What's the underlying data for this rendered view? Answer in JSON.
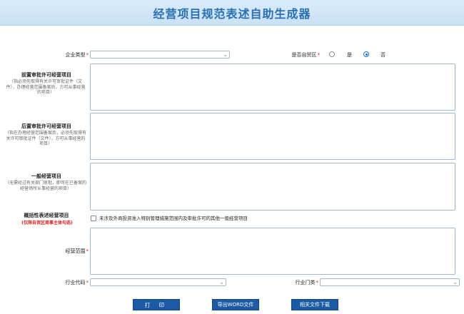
{
  "header": {
    "title": "经营项目规范表述自助生成器"
  },
  "form": {
    "enterprise_type": {
      "label": "企业类型",
      "value": ""
    },
    "free_trade_zone": {
      "label": "是否自贸区",
      "options": [
        "是",
        "否"
      ],
      "selected": "否"
    },
    "pre_approval": {
      "label": "前置审批许可经营项目",
      "note": "（指必须先取得有关许可审批证件（文件），办理经营范围备案后，方可从事经营的项目）",
      "value": ""
    },
    "post_approval": {
      "label": "后置审批许可经营项目",
      "note": "（指在办理经营范围备案后，必须先取得有关许可审批证件（文件），方可从事经营的项目）",
      "value": ""
    },
    "general": {
      "label": "一般经营项目",
      "note": "（无需经过有关部门审批，即可在已备案的经营场所从事经营的项目）",
      "value": ""
    },
    "summary": {
      "label": "概括性表述经营项目",
      "note": "(仅限自贸区商事主体勾选)",
      "checkbox_label": "未涉及外商投资准入特别管理措施范围内及审批许可的其他一般经营项目",
      "checked": false
    },
    "business_scope": {
      "label": "经营范围",
      "value": ""
    },
    "industry_code": {
      "label": "行业代码",
      "value": ""
    },
    "industry_category": {
      "label": "行业门类",
      "value": ""
    }
  },
  "buttons": {
    "print": "打 印",
    "export_word": "导出WORD文件",
    "download": "相关文件下载"
  },
  "required_mark": "*",
  "colors": {
    "accent": "#1c5aa6",
    "title": "#2a6fb5",
    "required": "#d62020"
  }
}
